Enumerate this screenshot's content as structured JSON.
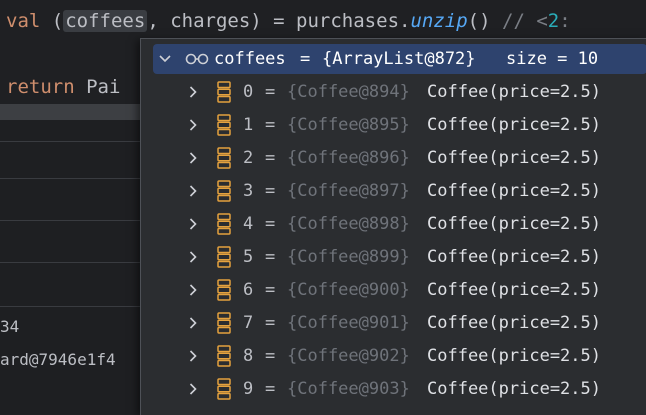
{
  "editor": {
    "line1": {
      "keyword": "val",
      "open_paren": "(",
      "var1": "coffees",
      "comma": ",",
      "var2": "charges",
      "rest": ") = purchases.",
      "func": "unzip",
      "call": "()",
      "comment": "//",
      "hint_lt": "<",
      "hint_num": "2",
      "hint_rest": ":"
    },
    "line2": {
      "keyword": "return",
      "rest": "Pai"
    }
  },
  "left_panel": {
    "texts": [
      "34",
      "ard@7946e1f4"
    ]
  },
  "debug_popup": {
    "header": {
      "name": "coffees",
      "equals": "=",
      "ref": "{ArrayList@872}",
      "size_label": "size = 10"
    },
    "items": [
      {
        "index": "0",
        "equals": "=",
        "ref": "{Coffee@894}",
        "value": "Coffee(price=2.5)"
      },
      {
        "index": "1",
        "equals": "=",
        "ref": "{Coffee@895}",
        "value": "Coffee(price=2.5)"
      },
      {
        "index": "2",
        "equals": "=",
        "ref": "{Coffee@896}",
        "value": "Coffee(price=2.5)"
      },
      {
        "index": "3",
        "equals": "=",
        "ref": "{Coffee@897}",
        "value": "Coffee(price=2.5)"
      },
      {
        "index": "4",
        "equals": "=",
        "ref": "{Coffee@898}",
        "value": "Coffee(price=2.5)"
      },
      {
        "index": "5",
        "equals": "=",
        "ref": "{Coffee@899}",
        "value": "Coffee(price=2.5)"
      },
      {
        "index": "6",
        "equals": "=",
        "ref": "{Coffee@900}",
        "value": "Coffee(price=2.5)"
      },
      {
        "index": "7",
        "equals": "=",
        "ref": "{Coffee@901}",
        "value": "Coffee(price=2.5)"
      },
      {
        "index": "8",
        "equals": "=",
        "ref": "{Coffee@902}",
        "value": "Coffee(price=2.5)"
      },
      {
        "index": "9",
        "equals": "=",
        "ref": "{Coffee@903}",
        "value": "Coffee(price=2.5)"
      }
    ]
  },
  "icons": {
    "expand": "chevron-right-icon",
    "collapse": "chevron-down-icon",
    "watch": "glasses-icon",
    "field": "list-field-icon"
  },
  "colors": {
    "keyword": "#cf8e6d",
    "function": "#56a8f5",
    "header_bg": "#2e436e",
    "field_icon": "#e5a23e"
  }
}
